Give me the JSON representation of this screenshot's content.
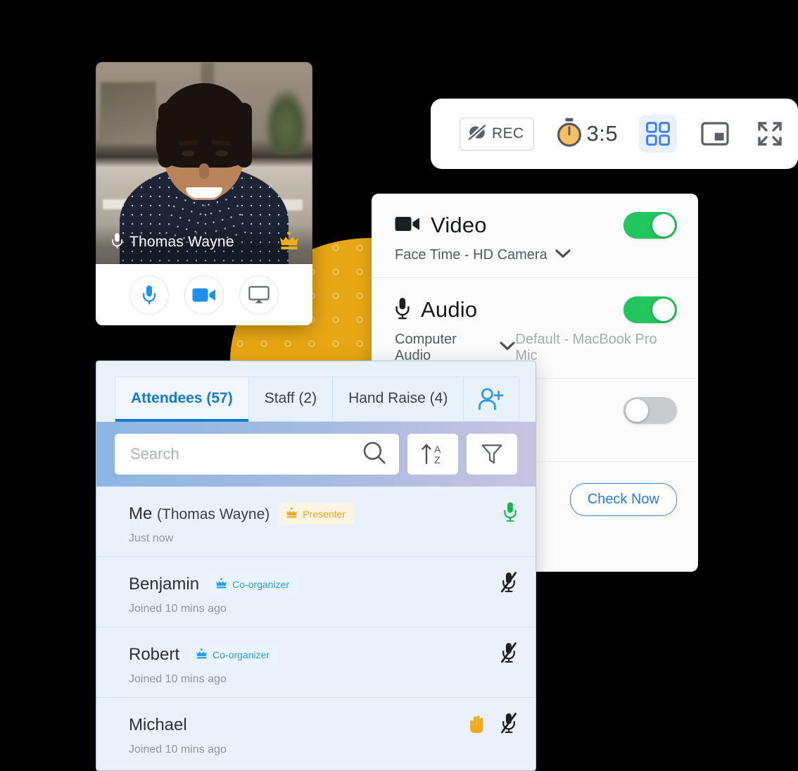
{
  "toolbar": {
    "rec_label": "REC",
    "rec_icon": "record-off-icon",
    "timer_icon": "stopwatch-icon",
    "timer_value": "3:5",
    "grid_icon": "grid-view-icon",
    "pip_icon": "picture-in-picture-icon",
    "fullscreen_icon": "fullscreen-icon"
  },
  "video_tile": {
    "name": "Thomas Wayne",
    "mic_icon": "microphone-icon",
    "crown_icon": "crown-icon",
    "actions": [
      {
        "name": "mic-button",
        "icon": "microphone-icon"
      },
      {
        "name": "camera-button",
        "icon": "video-camera-icon"
      },
      {
        "name": "screen-share-button",
        "icon": "airplay-icon"
      }
    ]
  },
  "settings": {
    "video": {
      "title": "Video",
      "icon": "video-camera-icon",
      "device": "Face Time - HD Camera",
      "chevron_icon": "chevron-down-icon",
      "enabled": true
    },
    "audio": {
      "title": "Audio",
      "icon": "microphone-icon",
      "source": "Computer Audio",
      "chevron_icon": "chevron-down-icon",
      "device": "Default - MacBook Pro Mic",
      "enabled": true
    },
    "third": {
      "enabled": false
    },
    "check_button": "Check Now"
  },
  "attendees_panel": {
    "tabs": [
      {
        "label": "Attendees",
        "count": "(57)",
        "active": true
      },
      {
        "label": "Staff",
        "count": "(2)",
        "active": false
      },
      {
        "label": "Hand Raise",
        "count": "(4)",
        "active": false
      }
    ],
    "add_person_icon": "add-person-icon",
    "search": {
      "placeholder": "Search",
      "search_icon": "search-icon",
      "sort_icon": "sort-alpha-icon",
      "filter_icon": "filter-icon"
    },
    "items": [
      {
        "name": "Me",
        "paren": "(Thomas Wayne)",
        "badge": "Presenter",
        "badge_type": "presenter",
        "badge_icon": "crown-icon",
        "sub": "Just now",
        "mic": "unmuted",
        "hand": false
      },
      {
        "name": "Benjamin",
        "paren": "",
        "badge": "Co-organizer",
        "badge_type": "organizer",
        "badge_icon": "crown-icon",
        "sub": "Joined 10 mins ago",
        "mic": "muted",
        "hand": false
      },
      {
        "name": "Robert",
        "paren": "",
        "badge": "Co-organizer",
        "badge_type": "organizer",
        "badge_icon": "crown-icon",
        "sub": "Joined 10 mins ago",
        "mic": "muted",
        "hand": false
      },
      {
        "name": "Michael",
        "paren": "",
        "badge": "",
        "badge_type": "",
        "badge_icon": "",
        "sub": "Joined 10 mins ago",
        "mic": "muted",
        "hand": true,
        "hand_icon": "raised-hand-icon"
      }
    ]
  },
  "colors": {
    "accent_blue": "#1479d1",
    "toggle_on": "#22c55e",
    "toggle_off": "#c9cbcf",
    "presenter_amber": "#e8a92b",
    "organizer_blue": "#2b9df0",
    "blob_yellow": "#e8a714"
  }
}
